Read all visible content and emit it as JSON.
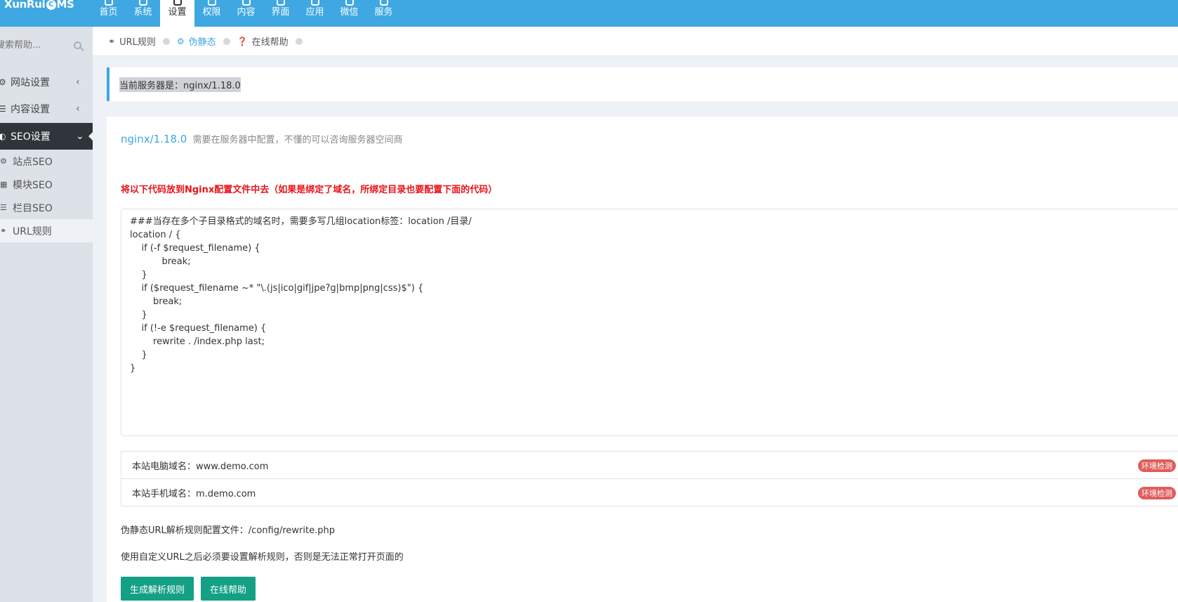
{
  "app": {
    "logo_text_left": "XunRui",
    "logo_circle": "C",
    "logo_text_right": "MS"
  },
  "topnav": {
    "items": [
      {
        "label": "首页",
        "active": false
      },
      {
        "label": "系统",
        "active": false
      },
      {
        "label": "设置",
        "active": true
      },
      {
        "label": "权限",
        "active": false
      },
      {
        "label": "内容",
        "active": false
      },
      {
        "label": "界面",
        "active": false
      },
      {
        "label": "应用",
        "active": false
      },
      {
        "label": "微信",
        "active": false
      },
      {
        "label": "服务",
        "active": false
      }
    ]
  },
  "sidebar": {
    "search_placeholder": "搜索帮助...",
    "menu": [
      {
        "label": "网站设置",
        "icon": "gear-icon",
        "arrow": "‹"
      },
      {
        "label": "内容设置",
        "icon": "list-icon",
        "arrow": "‹"
      },
      {
        "label": "SEO设置",
        "icon": "seo-icon",
        "arrow": "⌄",
        "active": true
      }
    ],
    "submenu": [
      {
        "label": "站点SEO",
        "icon": "gear-icon"
      },
      {
        "label": "模块SEO",
        "icon": "grid-icon"
      },
      {
        "label": "栏目SEO",
        "icon": "list-icon"
      },
      {
        "label": "URL规则",
        "icon": "link-icon",
        "active": true
      }
    ]
  },
  "tabs": [
    {
      "label": "URL规则",
      "icon": "link-icon",
      "active": false
    },
    {
      "label": "伪静态",
      "icon": "gear-icon",
      "active": true
    },
    {
      "label": "在线帮助",
      "icon": "question-icon",
      "active": false
    }
  ],
  "notice": {
    "text": "当前服务器是：nginx/1.18.0"
  },
  "panel": {
    "server_name": "nginx/1.18.0",
    "server_desc": "需要在服务器中配置，不懂的可以咨询服务器空间商",
    "warning": "将以下代码放到Nginx配置文件中去（如果是绑定了域名，所绑定目录也要配置下面的代码）",
    "code": "###当存在多个子目录格式的域名时，需要多写几组location标签：location /目录/\nlocation / {\n    if (-f $request_filename) {\n           break;\n    }\n    if ($request_filename ~* \"\\.(js|ico|gif|jpe?g|bmp|png|css)$\") {\n        break;\n    }\n    if (!-e $request_filename) {\n        rewrite . /index.php last;\n    }\n}",
    "domains": [
      {
        "label": "本站电脑域名：www.demo.com",
        "badge": "环境检测"
      },
      {
        "label": "本站手机域名：m.demo.com",
        "badge": "环境检测"
      }
    ],
    "config_file": "伪静态URL解析规则配置文件：/config/rewrite.php",
    "hint": "使用自定义URL之后必须要设置解析规则，否则是无法正常打开页面的",
    "btn_generate": "生成解析规则",
    "btn_help": "在线帮助"
  }
}
